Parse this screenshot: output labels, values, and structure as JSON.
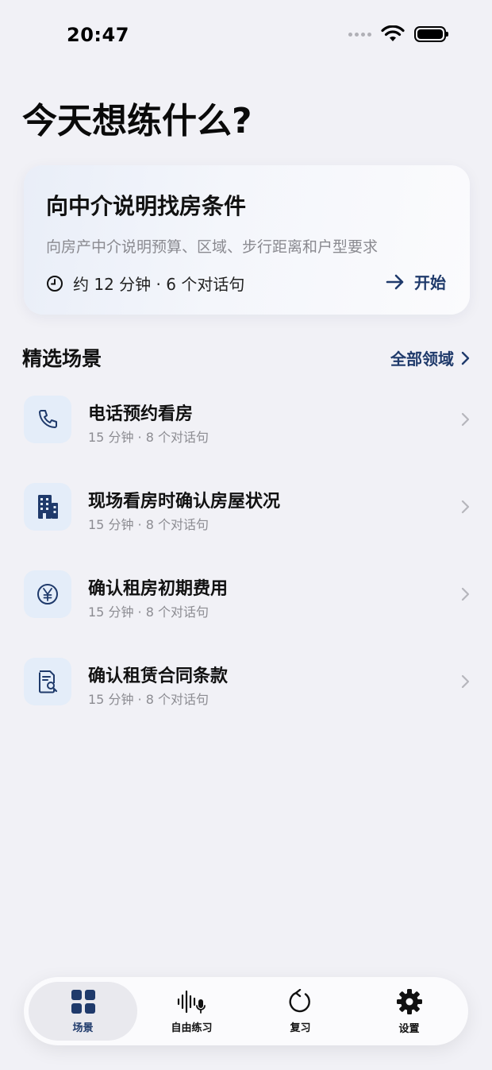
{
  "status_bar": {
    "time": "20:47"
  },
  "page_title": "今天想练什么?",
  "hero": {
    "title": "向中介说明找房条件",
    "description": "向房产中介说明预算、区域、步行距离和户型要求",
    "meta": "约 12 分钟 · 6 个对话句",
    "start_label": "开始",
    "accent": "#1f3a6b"
  },
  "section": {
    "title": "精选场景",
    "link_label": "全部领域"
  },
  "scenes": [
    {
      "title": "电话预约看房",
      "meta": "15 分钟 · 8 个对话句",
      "icon": "phone-icon"
    },
    {
      "title": "现场看房时确认房屋状况",
      "meta": "15 分钟 · 8 个对话句",
      "icon": "building-icon"
    },
    {
      "title": "确认租房初期费用",
      "meta": "15 分钟 · 8 个对话句",
      "icon": "yen-icon"
    },
    {
      "title": "确认租赁合同条款",
      "meta": "15 分钟 · 8 个对话句",
      "icon": "document-search-icon"
    }
  ],
  "tabs": [
    {
      "label": "场景",
      "icon": "grid-icon",
      "active": true
    },
    {
      "label": "自由练习",
      "icon": "waveform-mic-icon",
      "active": false
    },
    {
      "label": "复习",
      "icon": "refresh-icon",
      "active": false
    },
    {
      "label": "设置",
      "icon": "gear-icon",
      "active": false
    }
  ]
}
